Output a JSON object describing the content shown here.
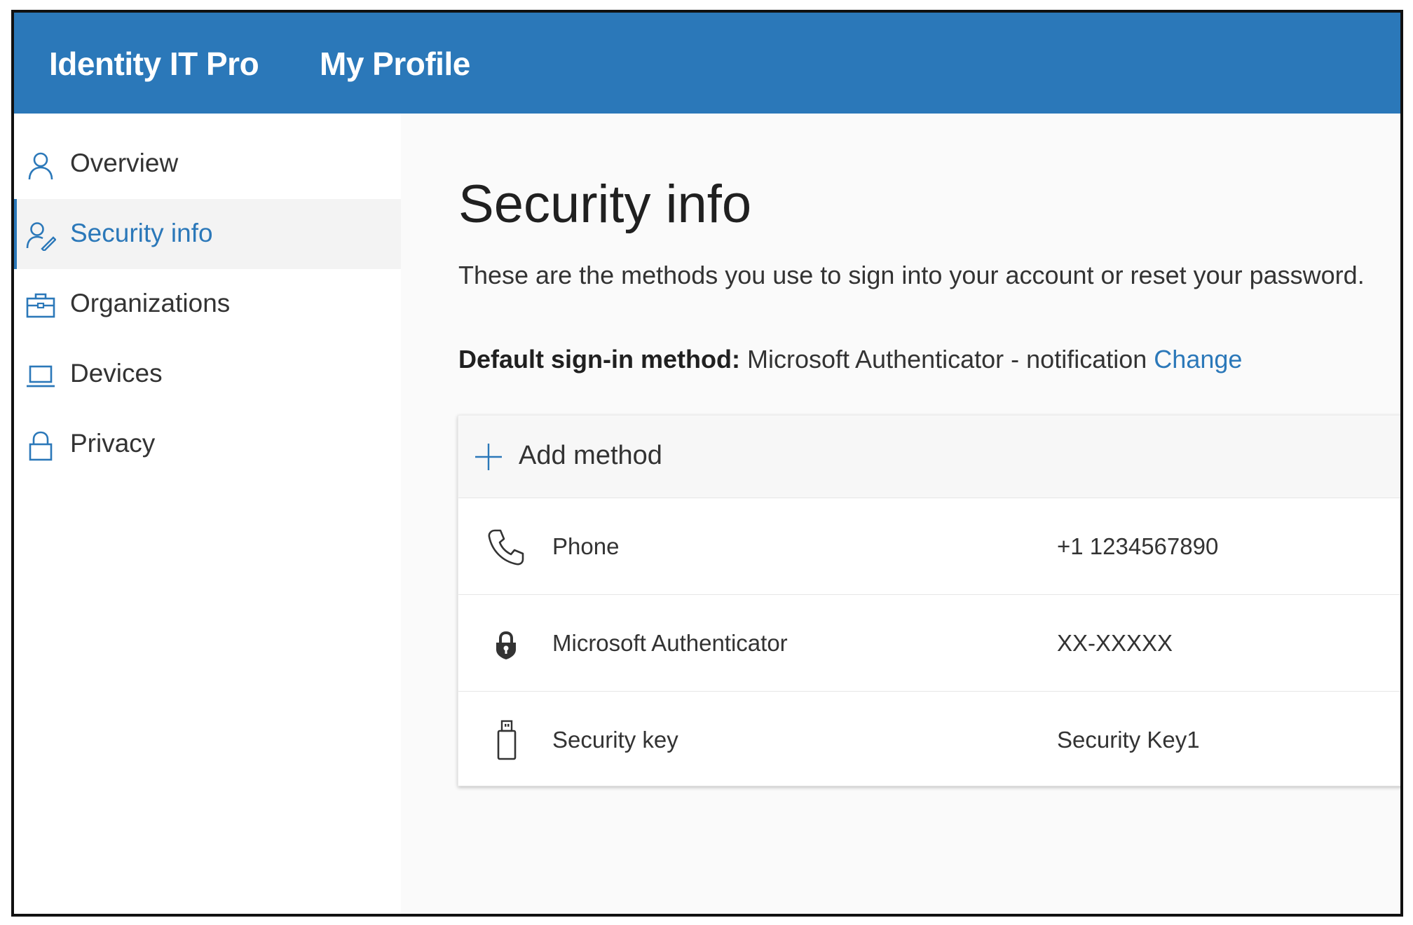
{
  "header": {
    "org_name": "Identity IT Pro",
    "app_name": "My Profile"
  },
  "sidebar": {
    "items": [
      {
        "label": "Overview",
        "icon": "person-icon",
        "active": false
      },
      {
        "label": "Security info",
        "icon": "person-key-icon",
        "active": true
      },
      {
        "label": "Organizations",
        "icon": "briefcase-icon",
        "active": false
      },
      {
        "label": "Devices",
        "icon": "laptop-icon",
        "active": false
      },
      {
        "label": "Privacy",
        "icon": "lock-icon",
        "active": false
      }
    ]
  },
  "main": {
    "title": "Security info",
    "description": "These are the methods you use to sign into your account or reset your password.",
    "default_method": {
      "label": "Default sign-in method:",
      "value": "Microsoft Authenticator - notification",
      "change_link": "Change"
    },
    "add_method_label": "Add method",
    "methods": [
      {
        "name": "Phone",
        "detail": "+1 1234567890",
        "icon": "phone-icon"
      },
      {
        "name": "Microsoft Authenticator",
        "detail": "XX-XXXXX",
        "icon": "authenticator-lock-icon"
      },
      {
        "name": "Security key",
        "detail": "Security Key1",
        "icon": "usb-key-icon"
      }
    ]
  },
  "colors": {
    "brand": "#2b78b9",
    "text": "#333333",
    "content_bg": "#fafafa"
  }
}
